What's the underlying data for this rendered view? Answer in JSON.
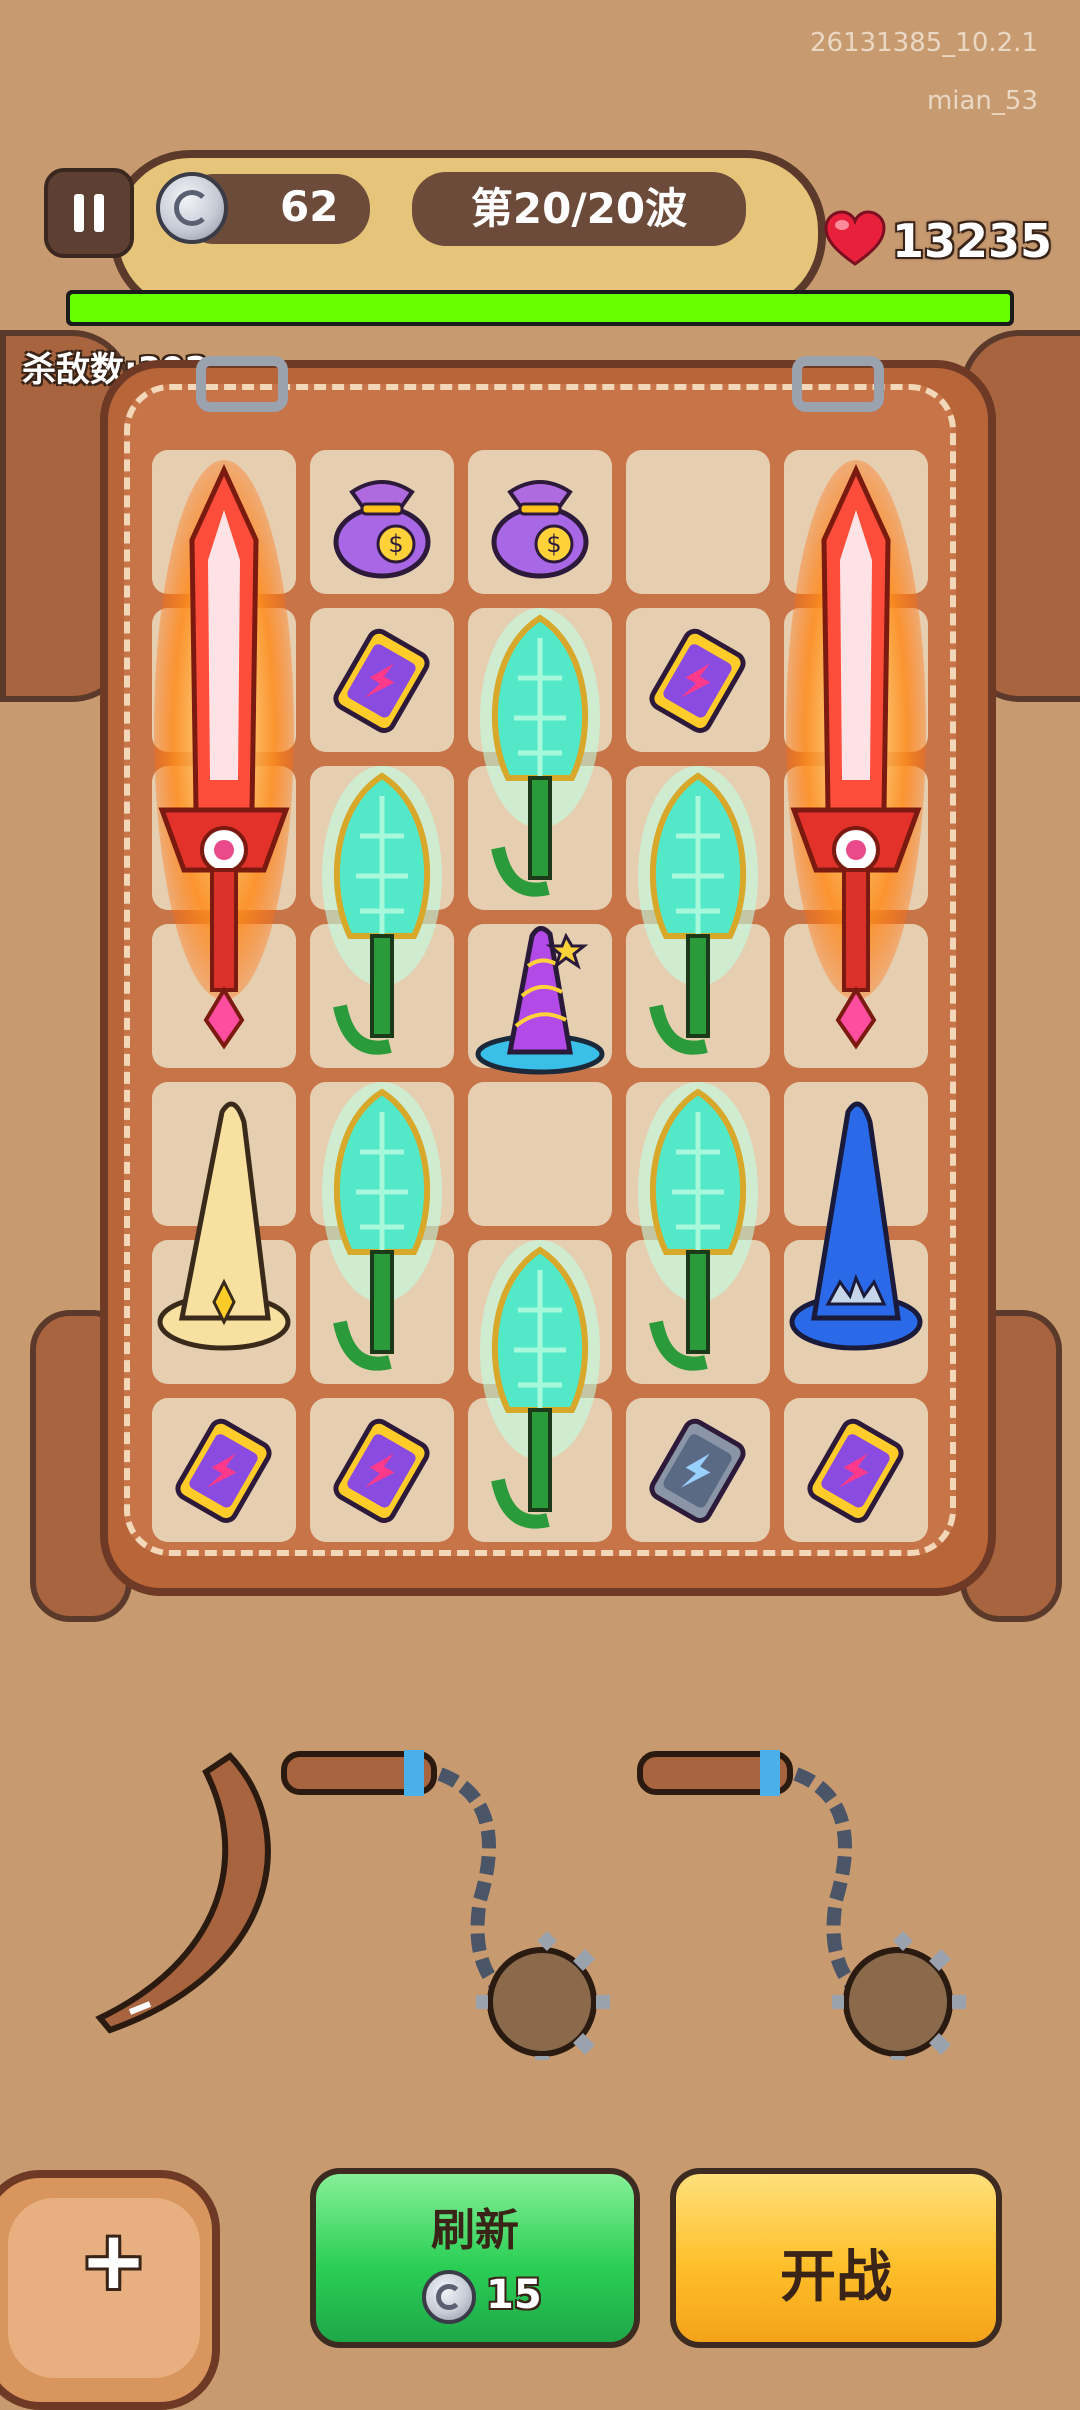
{
  "watermark": {
    "build": "26131385_10.2.1",
    "user": "mian_53"
  },
  "hud": {
    "coins": "62",
    "wave": "第20/20波",
    "hp": "13235",
    "hp_fraction": 1.0,
    "kills": "杀敌数:392"
  },
  "inventory": {
    "grid": {
      "rows": 7,
      "cols": 5
    },
    "items": [
      {
        "name": "flame-sword",
        "icon": "flame-sword-icon"
      },
      {
        "name": "money-bag",
        "icon": "money-bag-icon"
      },
      {
        "name": "battery",
        "icon": "battery-icon"
      },
      {
        "name": "jade-scepter",
        "icon": "jade-scepter-icon"
      },
      {
        "name": "wizard-hat",
        "icon": "wizard-hat-icon"
      }
    ]
  },
  "shop": {
    "offers": [
      "boomerang-icon",
      "flail-icon",
      "flail-icon"
    ]
  },
  "buttons": {
    "add": "+",
    "refresh_label": "刷新",
    "refresh_cost": "15",
    "start_label": "开战"
  },
  "colors": {
    "hp_bar": "#66ff00",
    "refresh": "#2bcf55",
    "start": "#ffbf2a"
  }
}
